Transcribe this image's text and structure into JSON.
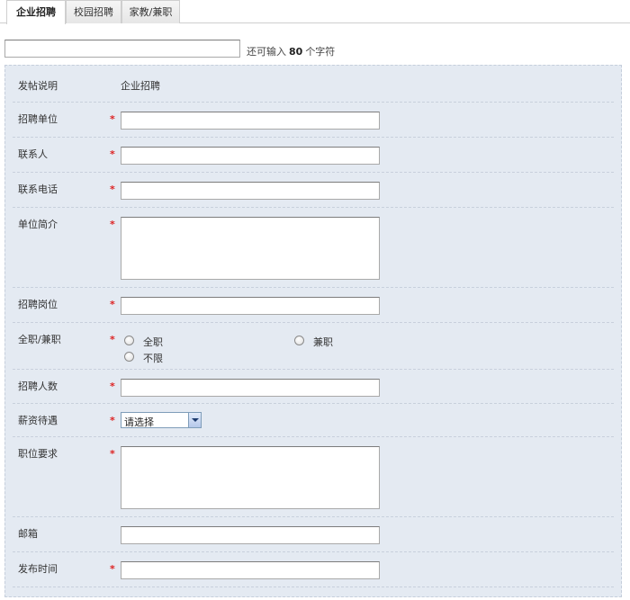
{
  "tabs": [
    {
      "label": "企业招聘"
    },
    {
      "label": "校园招聘"
    },
    {
      "label": "家教/兼职"
    }
  ],
  "title_field": {
    "value": "",
    "counter_prefix": "还可输入",
    "counter_value": "80",
    "counter_suffix": "个字符"
  },
  "form": {
    "post_type": {
      "label": "发帖说明",
      "value": "企业招聘"
    },
    "company": {
      "label": "招聘单位",
      "required": "*",
      "value": ""
    },
    "contact": {
      "label": "联系人",
      "required": "*",
      "value": ""
    },
    "phone": {
      "label": "联系电话",
      "required": "*",
      "value": ""
    },
    "intro": {
      "label": "单位简介",
      "required": "*",
      "value": ""
    },
    "position": {
      "label": "招聘岗位",
      "required": "*",
      "value": ""
    },
    "job_type": {
      "label": "全职/兼职",
      "required": "*",
      "options": [
        "全职",
        "兼职",
        "不限"
      ]
    },
    "headcount": {
      "label": "招聘人数",
      "required": "*",
      "value": ""
    },
    "salary": {
      "label": "薪资待遇",
      "required": "*",
      "selected": "请选择"
    },
    "requirements": {
      "label": "职位要求",
      "required": "*",
      "value": ""
    },
    "email": {
      "label": "邮箱",
      "value": ""
    },
    "publish_time": {
      "label": "发布时间",
      "required": "*",
      "value": ""
    }
  },
  "colors": {
    "panel_bg": "#e4eaf2",
    "required_star": "#dd2222",
    "border": "#a9a9a9"
  }
}
